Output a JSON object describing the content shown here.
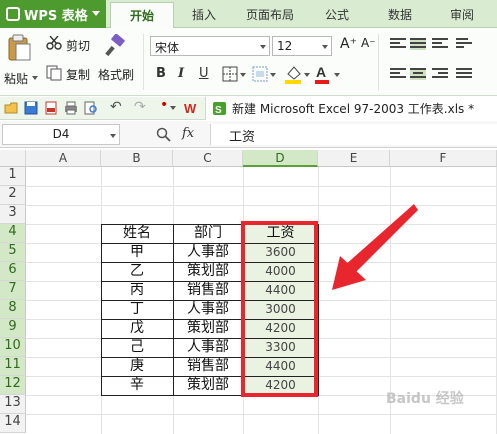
{
  "app": {
    "title": "WPS 表格",
    "tabs": [
      "开始",
      "插入",
      "页面布局",
      "公式",
      "数据",
      "审阅"
    ],
    "active_tab": "开始"
  },
  "ribbon": {
    "paste_label": "粘贴",
    "cut_label": "剪切",
    "copy_label": "复制",
    "format_painter_label": "格式刷",
    "font_name": "宋体",
    "font_size": "12",
    "bold": "B",
    "italic": "I",
    "underline": "U"
  },
  "document": {
    "tab_title": "新建 Microsoft Excel 97-2003 工作表.xls *"
  },
  "formula_bar": {
    "cell_ref": "D4",
    "fx": "fx",
    "content": "工资"
  },
  "sheet": {
    "columns": [
      "A",
      "B",
      "C",
      "D",
      "E",
      "F"
    ],
    "selected_column": "D",
    "rows": [
      "1",
      "2",
      "3",
      "4",
      "5",
      "6",
      "7",
      "8",
      "9",
      "10",
      "11",
      "12",
      "13",
      "14"
    ],
    "table": {
      "headers": [
        "姓名",
        "部门",
        "工资"
      ],
      "rows": [
        [
          "甲",
          "人事部",
          "3600"
        ],
        [
          "乙",
          "策划部",
          "4000"
        ],
        [
          "丙",
          "销售部",
          "4400"
        ],
        [
          "丁",
          "人事部",
          "3000"
        ],
        [
          "戊",
          "策划部",
          "4200"
        ],
        [
          "己",
          "人事部",
          "3300"
        ],
        [
          "庚",
          "销售部",
          "4400"
        ],
        [
          "辛",
          "策划部",
          "4200"
        ]
      ]
    }
  },
  "annotation": {
    "highlight_color": "#e8262d",
    "arrow_color": "#e8262d"
  },
  "colors": {
    "brand_green": "#4d9a2f",
    "selection_green": "#eaf3e2",
    "header_green": "#d3e8c6"
  },
  "watermark": "Baidu 经验"
}
